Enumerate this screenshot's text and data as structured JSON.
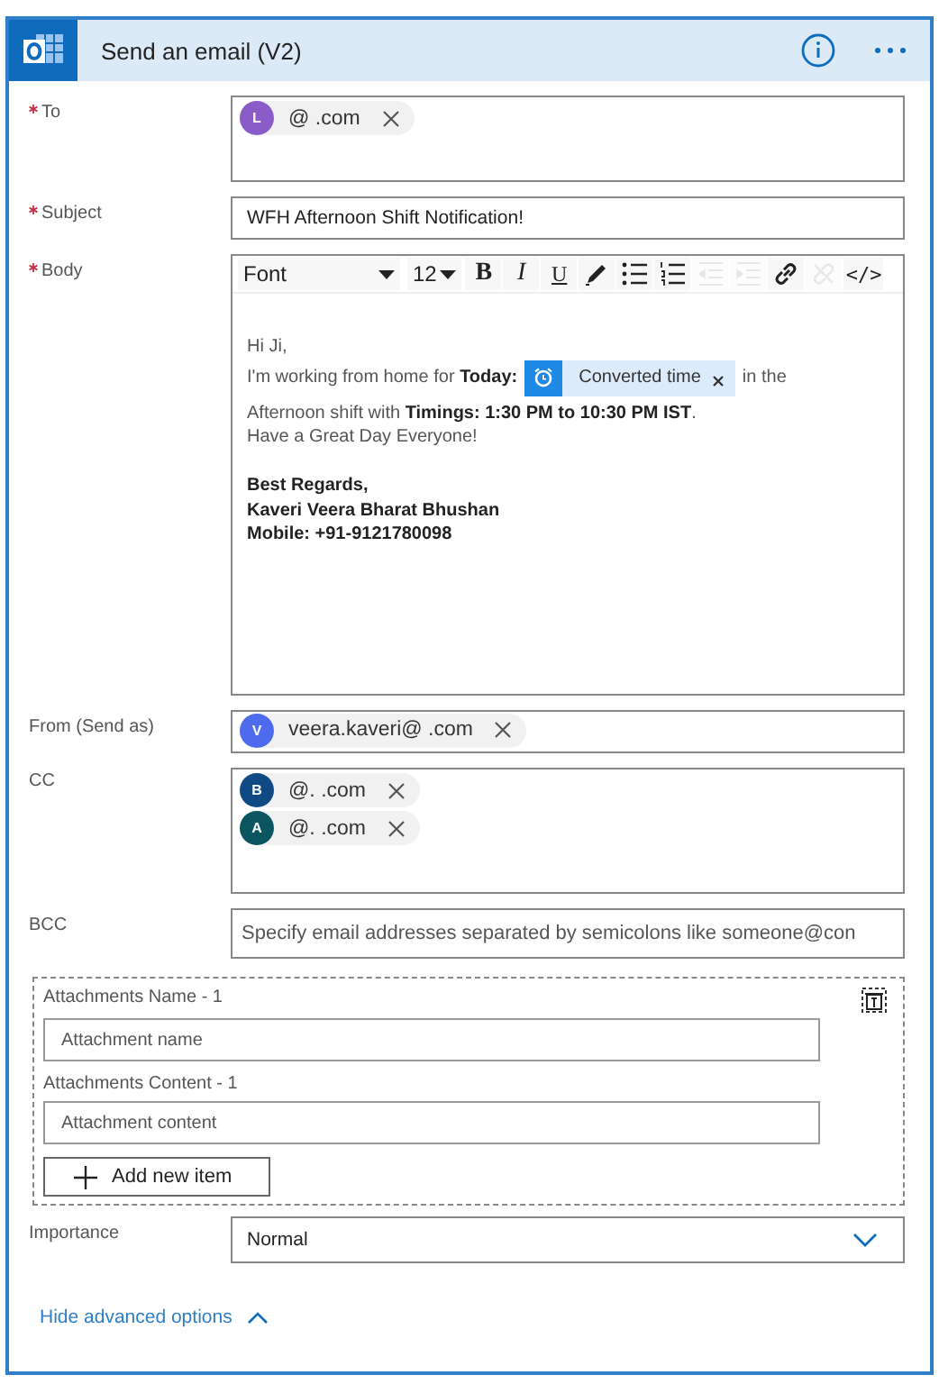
{
  "card": {
    "title": "Send an email (V2)"
  },
  "to": {
    "label": "To",
    "required": true,
    "recipients": [
      {
        "initial": "L",
        "color": "#8a5cc7",
        "address": "@ .com"
      }
    ]
  },
  "subject": {
    "label": "Subject",
    "required": true,
    "value": "WFH Afternoon Shift Notification!"
  },
  "body": {
    "label": "Body",
    "required": true,
    "toolbar": {
      "font": "Font",
      "size": "12",
      "tools": [
        {
          "kind": "bold",
          "label": "B",
          "disabled": false
        },
        {
          "kind": "italic",
          "label": "I",
          "disabled": false
        },
        {
          "kind": "underline",
          "label": "U",
          "disabled": false
        },
        {
          "kind": "pen",
          "disabled": false
        },
        {
          "kind": "bullets",
          "disabled": false
        },
        {
          "kind": "numbers",
          "disabled": false
        },
        {
          "kind": "outdent",
          "disabled": true
        },
        {
          "kind": "indent",
          "disabled": true
        },
        {
          "kind": "link",
          "disabled": false
        },
        {
          "kind": "unlink",
          "disabled": true
        },
        {
          "kind": "code",
          "label": "</>",
          "disabled": false
        }
      ]
    },
    "lines": [
      {
        "kind": "text",
        "text": "Hi Ji,"
      },
      {
        "kind": "token",
        "before": "I'm working from home for **Today:**",
        "token": "Converted time",
        "after": "in the"
      },
      {
        "kind": "text",
        "text": "Afternoon shift with **Timings: 1:30 PM to 10:30 PM IST**."
      },
      {
        "kind": "text",
        "text": "Have a Great Day Everyone!"
      },
      {
        "kind": "blank"
      },
      {
        "kind": "text",
        "text": "**Best Regards,**"
      },
      {
        "kind": "text",
        "text": "**Kaveri Veera Bharat Bhushan**"
      },
      {
        "kind": "text",
        "text": "**Mobile: +91-9121780098**"
      }
    ]
  },
  "from": {
    "label": "From (Send as)",
    "required": false,
    "recipients": [
      {
        "initial": "V",
        "color": "#4f6bed",
        "address": "veera.kaveri@ .com"
      }
    ]
  },
  "cc": {
    "label": "CC",
    "required": false,
    "recipients": [
      {
        "initial": "B",
        "color": "#0f4a85",
        "address": "@. .com"
      },
      {
        "initial": "A",
        "color": "#0b5560",
        "address": "@. .com"
      }
    ]
  },
  "bcc": {
    "label": "BCC",
    "required": false,
    "placeholder": "Specify email addresses separated by semicolons like someone@con"
  },
  "attachments": {
    "name_label": "Attachments Name - 1",
    "name_placeholder": "Attachment name",
    "content_label": "Attachments Content - 1",
    "content_placeholder": "Attachment content",
    "add_button": "Add new item"
  },
  "importance": {
    "label": "Importance",
    "required": false,
    "value": "Normal"
  },
  "advanced_link": "Hide advanced options"
}
